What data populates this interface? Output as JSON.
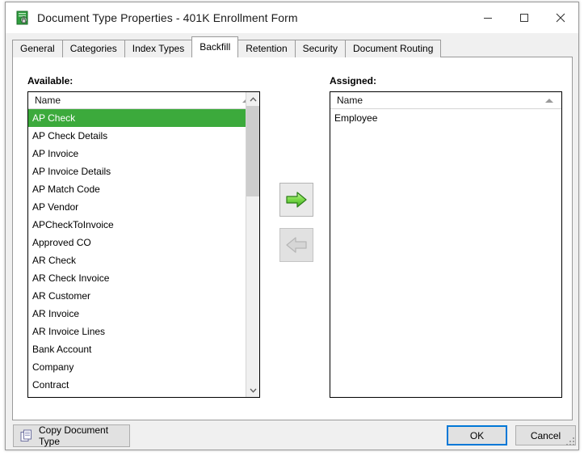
{
  "window": {
    "title": "Document Type Properties  - 401K Enrollment Form",
    "icon": "document-lock-green-icon",
    "controls": {
      "minimize": "minimize-icon",
      "maximize": "maximize-icon",
      "close": "close-icon"
    }
  },
  "tabs": [
    {
      "label": "General",
      "active": false
    },
    {
      "label": "Categories",
      "active": false
    },
    {
      "label": "Index Types",
      "active": false
    },
    {
      "label": "Backfill",
      "active": true
    },
    {
      "label": "Retention",
      "active": false
    },
    {
      "label": "Security",
      "active": false
    },
    {
      "label": "Document Routing",
      "active": false
    }
  ],
  "available": {
    "label": "Available:",
    "column_header": "Name",
    "sort_indicator": "sort-ascending-icon",
    "items": [
      {
        "name": "AP Check",
        "selected": true
      },
      {
        "name": "AP Check Details",
        "selected": false
      },
      {
        "name": "AP Invoice",
        "selected": false
      },
      {
        "name": "AP Invoice Details",
        "selected": false
      },
      {
        "name": "AP Match Code",
        "selected": false
      },
      {
        "name": "AP Vendor",
        "selected": false
      },
      {
        "name": "APCheckToInvoice",
        "selected": false
      },
      {
        "name": "Approved CO",
        "selected": false
      },
      {
        "name": "AR Check",
        "selected": false
      },
      {
        "name": "AR Check Invoice",
        "selected": false
      },
      {
        "name": "AR Customer",
        "selected": false
      },
      {
        "name": "AR Invoice",
        "selected": false
      },
      {
        "name": "AR Invoice Lines",
        "selected": false
      },
      {
        "name": "Bank Account",
        "selected": false
      },
      {
        "name": "Company",
        "selected": false
      },
      {
        "name": "Contract",
        "selected": false
      }
    ],
    "scrollbar": {
      "up_arrow": "chevron-up-icon",
      "down_arrow": "chevron-down-icon"
    }
  },
  "assigned": {
    "label": "Assigned:",
    "column_header": "Name",
    "sort_indicator": "sort-ascending-icon",
    "items": [
      {
        "name": "Employee",
        "selected": false
      }
    ]
  },
  "transfer": {
    "assign_icon": "arrow-right-green-icon",
    "unassign_icon": "arrow-left-grey-icon",
    "unassign_disabled": true
  },
  "footer": {
    "copy_label": "Copy Document Type",
    "copy_icon": "copy-documents-icon",
    "ok_label": "OK",
    "cancel_label": "Cancel",
    "resize_grip": "resize-grip-icon"
  },
  "colors": {
    "selection_green": "#3caa3c",
    "focus_blue": "#0078d7",
    "arrow_green": "#55cc33",
    "window_bg": "#f0f0f0"
  }
}
